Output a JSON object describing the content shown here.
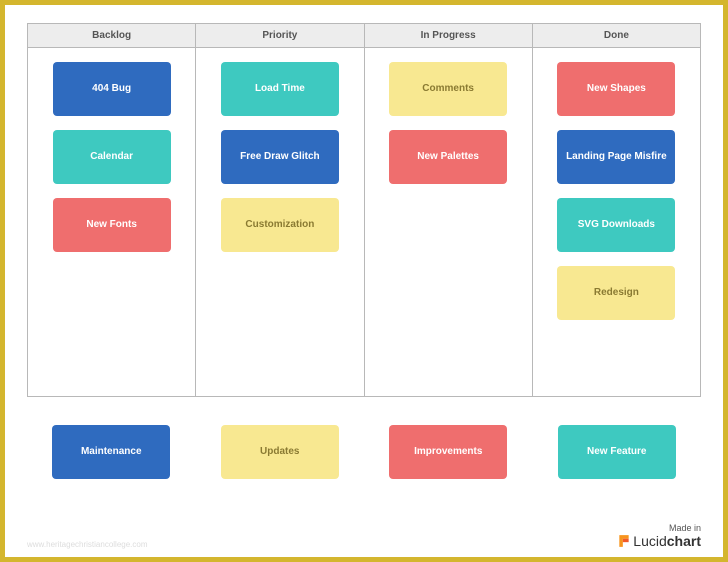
{
  "columns": [
    {
      "header": "Backlog",
      "cards": [
        {
          "label": "404 Bug",
          "color": "c-blue"
        },
        {
          "label": "Calendar",
          "color": "c-teal"
        },
        {
          "label": "New Fonts",
          "color": "c-red"
        }
      ]
    },
    {
      "header": "Priority",
      "cards": [
        {
          "label": "Load Time",
          "color": "c-teal"
        },
        {
          "label": "Free Draw Glitch",
          "color": "c-blue"
        },
        {
          "label": "Customization",
          "color": "c-yellow"
        }
      ]
    },
    {
      "header": "In Progress",
      "cards": [
        {
          "label": "Comments",
          "color": "c-yellow"
        },
        {
          "label": "New Palettes",
          "color": "c-red"
        }
      ]
    },
    {
      "header": "Done",
      "cards": [
        {
          "label": "New Shapes",
          "color": "c-red"
        },
        {
          "label": "Landing Page Misfire",
          "color": "c-blue"
        },
        {
          "label": "SVG Downloads",
          "color": "c-teal"
        },
        {
          "label": "Redesign",
          "color": "c-yellow"
        }
      ]
    }
  ],
  "legend": [
    {
      "label": "Maintenance",
      "color": "c-blue"
    },
    {
      "label": "Updates",
      "color": "c-yellow"
    },
    {
      "label": "Improvements",
      "color": "c-red"
    },
    {
      "label": "New Feature",
      "color": "c-teal"
    }
  ],
  "footer": {
    "madein": "Made in",
    "brand_light": "Lucid",
    "brand_bold": "chart"
  },
  "watermark": "www.heritagechristiancollege.com"
}
